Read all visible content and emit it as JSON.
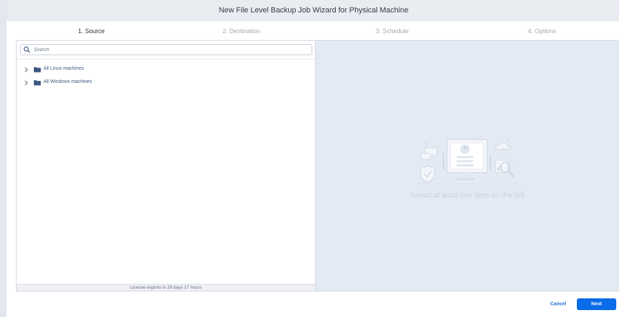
{
  "window": {
    "title": "New File Level Backup Job Wizard for Physical Machine"
  },
  "steps": [
    {
      "label": "1. Source",
      "active": true
    },
    {
      "label": "2. Destination",
      "active": false
    },
    {
      "label": "3. Schedule",
      "active": false
    },
    {
      "label": "4. Options",
      "active": false
    }
  ],
  "search": {
    "placeholder": "Search",
    "value": ""
  },
  "tree": [
    {
      "label": "All Linux machines",
      "icon": "folder-icon"
    },
    {
      "label": "All Windows machines",
      "icon": "folder-icon"
    }
  ],
  "license": {
    "text": "License expires in 29 days 17 hours"
  },
  "empty_state": {
    "text": "Select at least one item on the left"
  },
  "footer": {
    "cancel_label": "Cancel",
    "next_label": "Next"
  },
  "colors": {
    "accent": "#0a6ce8",
    "link": "#1f6fd1",
    "panel_bg": "#e4eaf4",
    "tree_text": "#3d5a7e"
  }
}
